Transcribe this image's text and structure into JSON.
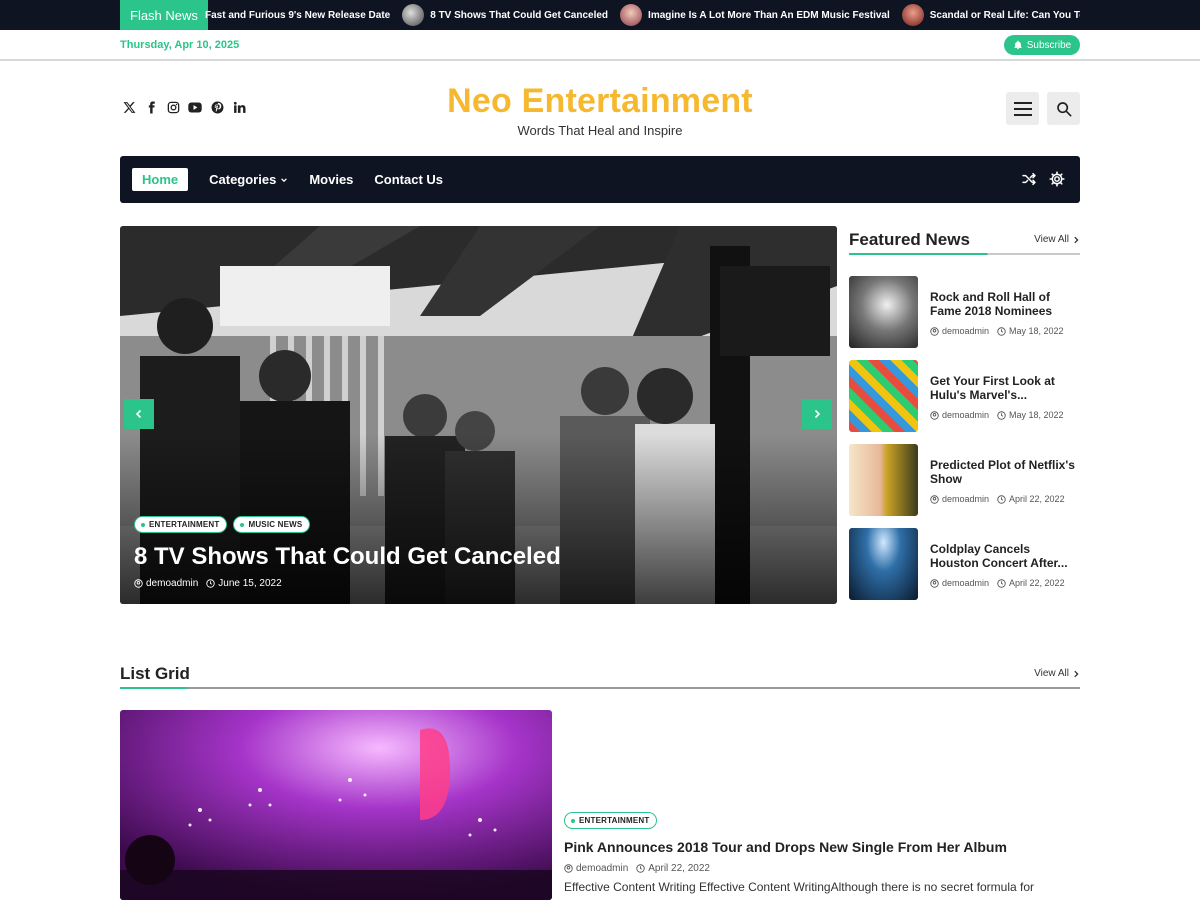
{
  "ticker": {
    "label": "Flash News",
    "items": [
      {
        "text": "Fast and Furious 9's New Release Date",
        "thumb": false
      },
      {
        "text": "8 TV Shows That Could Get Canceled",
        "thumb": true
      },
      {
        "text": "Imagine Is A Lot More Than An EDM Music Festival",
        "thumb": true
      },
      {
        "text": "Scandal or Real Life: Can You Tell the Diffe",
        "thumb": true
      }
    ]
  },
  "topbar": {
    "date": "Thursday, Apr 10, 2025",
    "subscribe_label": "Subscribe"
  },
  "social_icons": [
    "x-icon",
    "facebook-icon",
    "instagram-icon",
    "youtube-icon",
    "pinterest-icon",
    "linkedin-icon"
  ],
  "brand": {
    "title": "Neo Entertainment",
    "tagline": "Words That Heal and Inspire"
  },
  "nav": {
    "items": [
      {
        "label": "Home",
        "active": true
      },
      {
        "label": "Categories",
        "dropdown": true
      },
      {
        "label": "Movies"
      },
      {
        "label": "Contact Us"
      }
    ]
  },
  "slider": {
    "categories": [
      "ENTERTAINMENT",
      "MUSIC NEWS"
    ],
    "title": "8 TV Shows That Could Get Canceled",
    "author": "demoadmin",
    "date": "June 15, 2022"
  },
  "featured": {
    "heading": "Featured News",
    "view_all": "View All",
    "items": [
      {
        "title": "Rock and Roll Hall of Fame 2018 Nominees",
        "author": "demoadmin",
        "date": "May 18, 2022"
      },
      {
        "title": "Get Your First Look at Hulu's Marvel's...",
        "author": "demoadmin",
        "date": "May 18, 2022"
      },
      {
        "title": "Predicted Plot of Netflix's Show",
        "author": "demoadmin",
        "date": "April 22, 2022"
      },
      {
        "title": "Coldplay Cancels Houston Concert After...",
        "author": "demoadmin",
        "date": "April 22, 2022"
      }
    ]
  },
  "list_grid": {
    "heading": "List Grid",
    "view_all": "View All",
    "post": {
      "category": "ENTERTAINMENT",
      "title": "Pink Announces 2018 Tour and Drops New Single From Her Album",
      "author": "demoadmin",
      "date": "April 22, 2022",
      "excerpt": "Effective Content Writing Effective Content WritingAlthough there is no secret formula for"
    }
  },
  "colors": {
    "accent": "#2bc48a",
    "brand": "#f5b82e",
    "dark": "#0f1422"
  }
}
